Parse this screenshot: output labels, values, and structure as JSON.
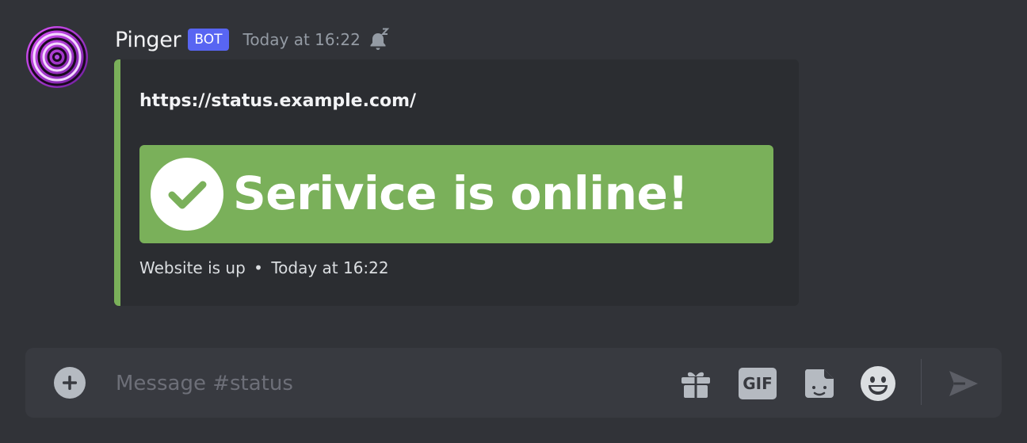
{
  "message": {
    "username": "Pinger",
    "badge": "BOT",
    "timestamp": "Today at 16:22",
    "avatar_icon": "ripple-target-avatar",
    "snooze_icon": "bell-snooze-icon"
  },
  "embed": {
    "title": "https://status.example.com/",
    "accent_color": "#7ab05a",
    "banner": {
      "text": "Serivice is online!",
      "icon": "check-circle-icon",
      "color": "#7ab05a"
    },
    "footer_text": "Website is up",
    "footer_separator": "•",
    "footer_timestamp": "Today at 16:22"
  },
  "composer": {
    "placeholder": "Message #status",
    "value": "",
    "buttons": {
      "add": "plus-circle-icon",
      "gift": "gift-icon",
      "gif_label": "GIF",
      "sticker": "sticker-icon",
      "emoji": "smile-emoji-icon",
      "send": "send-arrow-icon"
    }
  },
  "colors": {
    "background": "#313338",
    "embed_background": "#2b2d31",
    "composer_background": "#383a40",
    "bot_badge": "#5865f2",
    "muted_text": "#949ba4"
  }
}
